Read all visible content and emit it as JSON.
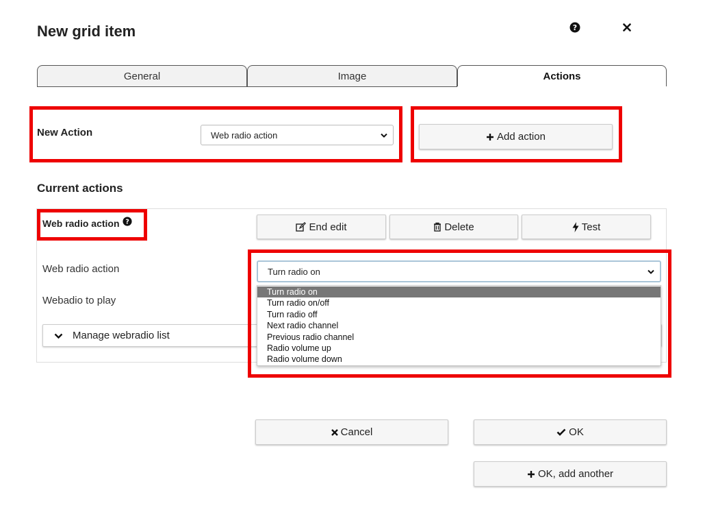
{
  "dialog": {
    "title": "New grid item"
  },
  "header_icons": {
    "help": "question-circle-icon",
    "close": "close-icon"
  },
  "tabs": [
    {
      "label": "General",
      "active": false
    },
    {
      "label": "Image",
      "active": false
    },
    {
      "label": "Actions",
      "active": true
    }
  ],
  "new_action": {
    "label": "New Action",
    "selected": "Web radio action",
    "add_button": "Add action"
  },
  "current_actions": {
    "title": "Current actions",
    "item": {
      "name": "Web radio action",
      "buttons": {
        "end_edit": "End edit",
        "delete": "Delete",
        "test": "Test"
      },
      "fields": {
        "web_radio_action_label": "Web radio action",
        "web_radio_action_value": "Turn radio on",
        "webradio_to_play_label": "Webadio to play"
      },
      "manage_list": "Manage webradio list",
      "options": [
        "Turn radio on",
        "Turn radio on/off",
        "Turn radio off",
        "Next radio channel",
        "Previous radio channel",
        "Radio volume up",
        "Radio volume down"
      ],
      "selected_option_index": 0
    }
  },
  "footer": {
    "cancel": "Cancel",
    "ok": "OK",
    "ok_add_another": "OK, add another"
  },
  "colors": {
    "highlight_border": "#ee0000",
    "selected_option_bg": "#777777",
    "focus_border": "#a9c5d8"
  }
}
